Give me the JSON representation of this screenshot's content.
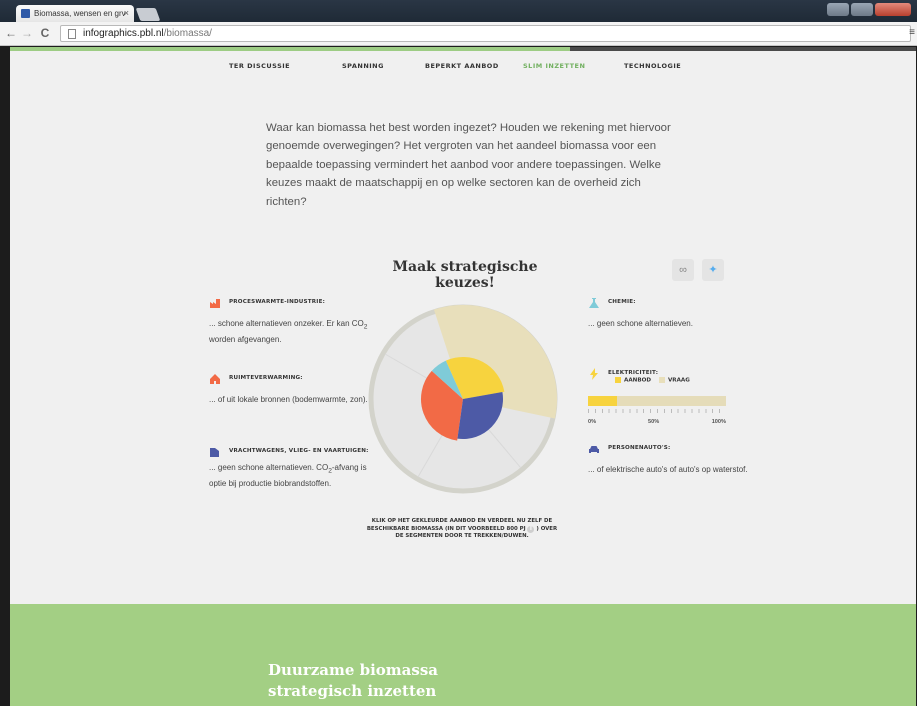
{
  "browser": {
    "tab_title": "Biomassa, wensen en grv",
    "url_host": "infographics.pbl.nl",
    "url_path": "/biomassa/"
  },
  "nav": {
    "items": [
      "TER DISCUSSIE",
      "SPANNING",
      "BEPERKT AANBOD",
      "SLIM INZETTEN",
      "TECHNOLOGIE"
    ],
    "active": "SLIM INZETTEN"
  },
  "intro": "Waar kan biomassa het best worden ingezet? Houden we rekening met hiervoor genoemde overwegingen? Het vergroten van het aandeel biomassa voor een bepaalde toepassing vermindert het aanbod voor andere toepassingen. Welke keuzes maakt de maatschappij en op welke sectoren kan de overheid zich richten?",
  "heading": "Maak strategische keuzes!",
  "share": {
    "link_icon": "link-icon",
    "twitter_icon": "twitter-icon"
  },
  "sectors": {
    "proceswarmte": {
      "title": "PROCESWARMTE-INDUSTRIE:",
      "desc_pre": "... schone alternatieven onzeker. Er kan CO",
      "desc_sub": "2",
      "desc_post": " worden afgevangen.",
      "icon": "factory-icon",
      "color": "#f26a46"
    },
    "ruimte": {
      "title": "RUIMTEVERWARMING:",
      "desc": "... of uit lokale bronnen (bodemwarmte, zon).",
      "icon": "house-icon",
      "color": "#f26a46"
    },
    "vracht": {
      "title": "VRACHTWAGENS, VLIEG- EN VAARTUIGEN:",
      "desc_pre": "... geen schone alternatieven. CO",
      "desc_sub": "2",
      "desc_post": "-afvang is optie bij productie biobrandstoffen.",
      "icon": "truck-icon",
      "color": "#4d5aa6"
    },
    "chemie": {
      "title": "CHEMIE:",
      "desc": "... geen schone alternatieven.",
      "icon": "flask-icon",
      "color": "#7fcbd8"
    },
    "elektriciteit": {
      "title": "ELEKTRICITEIT:",
      "legend_supply": "AANBOD",
      "legend_demand": "VRAAG",
      "icon": "lightning-icon",
      "color": "#f7d33e"
    },
    "auto": {
      "title": "PERSONENAUTO'S:",
      "desc": "... of elektrische auto's of auto's op waterstof.",
      "icon": "car-icon",
      "color": "#4d5aa6"
    }
  },
  "electricity_bar": {
    "supply_fraction": 0.21,
    "labels": [
      "0%",
      "50%",
      "100%"
    ]
  },
  "pie": {
    "segments": [
      {
        "name": "proceswarmte",
        "color": "#f26a46",
        "start": 188,
        "end": 312
      },
      {
        "name": "chemie",
        "color": "#7fcbd8",
        "start": 312,
        "end": 336
      },
      {
        "name": "elektriciteit",
        "color": "#f7d33e",
        "start": 336,
        "end": 440
      },
      {
        "name": "vracht",
        "color": "#4d5aa6",
        "start": 80,
        "end": 188
      }
    ],
    "demand_wedge": {
      "color": "#e8dfbb",
      "start": 342,
      "end": 462
    }
  },
  "instruction_pre": "Klik op het gekleurde aanbod en verdeel nu zelf de beschikbare biomassa (in dit voorbeeld 800 PJ",
  "instruction_info": "i",
  "instruction_post": ") over de segmenten door te trekken/duwen.",
  "footer_title": "Duurzame biomassa strategisch inzetten"
}
